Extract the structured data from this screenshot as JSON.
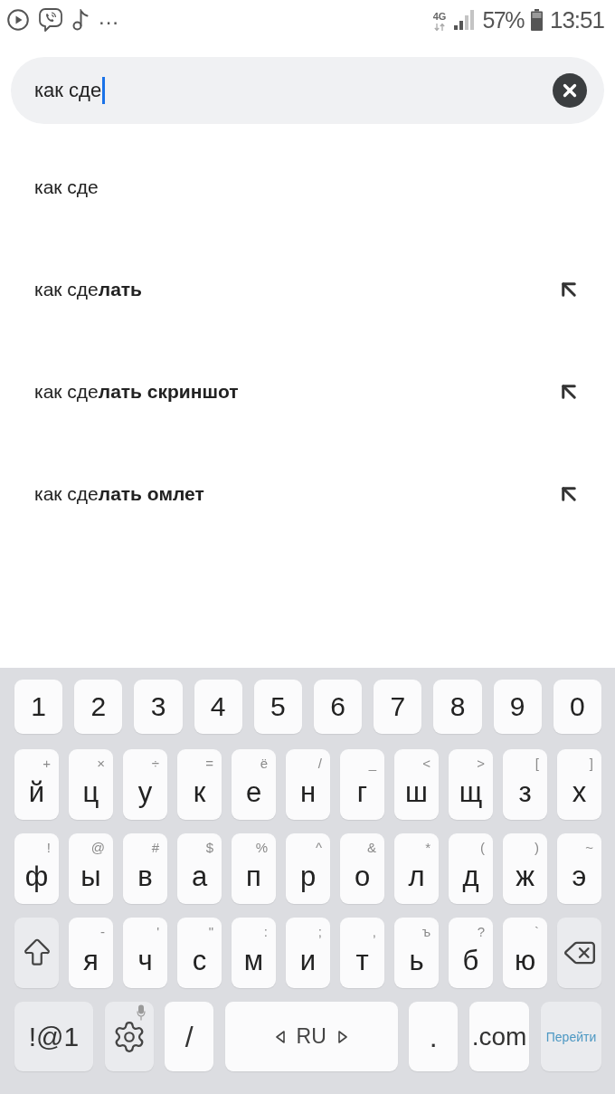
{
  "status_bar": {
    "overflow": "...",
    "network": "4G",
    "battery": "57%",
    "time": "13:51"
  },
  "search": {
    "value": "как сде"
  },
  "suggestions": [
    {
      "text": "как сде",
      "kind": "typed"
    },
    {
      "text": "как сде**лать**",
      "kind": "completion"
    },
    {
      "text": "как сде**лать скриншот**",
      "kind": "completion"
    },
    {
      "text": "как сде**лать омлет**",
      "kind": "completion"
    }
  ],
  "keyboard": {
    "rows": [
      {
        "kind": "numbers",
        "keys": [
          {
            "kind": "char",
            "label": "1"
          },
          {
            "kind": "char",
            "label": "2"
          },
          {
            "kind": "char",
            "label": "3"
          },
          {
            "kind": "char",
            "label": "4"
          },
          {
            "kind": "char",
            "label": "5"
          },
          {
            "kind": "char",
            "label": "6"
          },
          {
            "kind": "char",
            "label": "7"
          },
          {
            "kind": "char",
            "label": "8"
          },
          {
            "kind": "char",
            "label": "9"
          },
          {
            "kind": "char",
            "label": "0"
          }
        ]
      },
      {
        "kind": "letters",
        "keys": [
          {
            "kind": "char",
            "label": "й",
            "hint": "+"
          },
          {
            "kind": "char",
            "label": "ц",
            "hint": "×"
          },
          {
            "kind": "char",
            "label": "у",
            "hint": "÷"
          },
          {
            "kind": "char",
            "label": "к",
            "hint": "="
          },
          {
            "kind": "char",
            "label": "е",
            "hint": "ё"
          },
          {
            "kind": "char",
            "label": "н",
            "hint": "/"
          },
          {
            "kind": "char",
            "label": "г",
            "hint": "_"
          },
          {
            "kind": "char",
            "label": "ш",
            "hint": "<"
          },
          {
            "kind": "char",
            "label": "щ",
            "hint": ">"
          },
          {
            "kind": "char",
            "label": "з",
            "hint": "["
          },
          {
            "kind": "char",
            "label": "х",
            "hint": "]"
          }
        ]
      },
      {
        "kind": "letters",
        "keys": [
          {
            "kind": "char",
            "label": "ф",
            "hint": "!"
          },
          {
            "kind": "char",
            "label": "ы",
            "hint": "@"
          },
          {
            "kind": "char",
            "label": "в",
            "hint": "#"
          },
          {
            "kind": "char",
            "label": "а",
            "hint": "$"
          },
          {
            "kind": "char",
            "label": "п",
            "hint": "%"
          },
          {
            "kind": "char",
            "label": "р",
            "hint": "^"
          },
          {
            "kind": "char",
            "label": "о",
            "hint": "&"
          },
          {
            "kind": "char",
            "label": "л",
            "hint": "*"
          },
          {
            "kind": "char",
            "label": "д",
            "hint": "("
          },
          {
            "kind": "char",
            "label": "ж",
            "hint": ")"
          },
          {
            "kind": "char",
            "label": "э",
            "hint": "~"
          }
        ]
      },
      {
        "kind": "letters",
        "keys": [
          {
            "kind": "shift"
          },
          {
            "kind": "char",
            "label": "я",
            "hint": "-"
          },
          {
            "kind": "char",
            "label": "ч",
            "hint": "'"
          },
          {
            "kind": "char",
            "label": "с",
            "hint": "\""
          },
          {
            "kind": "char",
            "label": "м",
            "hint": ":"
          },
          {
            "kind": "char",
            "label": "и",
            "hint": ";"
          },
          {
            "kind": "char",
            "label": "т",
            "hint": ","
          },
          {
            "kind": "char",
            "label": "ь",
            "hint": "ъ"
          },
          {
            "kind": "char",
            "label": "б",
            "hint": "?"
          },
          {
            "kind": "char",
            "label": "ю",
            "hint": "`"
          },
          {
            "kind": "backspace"
          }
        ]
      },
      {
        "kind": "bottom",
        "keys": [
          {
            "kind": "symbols",
            "label": "!@1"
          },
          {
            "kind": "settings"
          },
          {
            "kind": "char",
            "label": "/"
          },
          {
            "kind": "space",
            "label": "RU"
          },
          {
            "kind": "char",
            "label": "."
          },
          {
            "kind": "char",
            "label": ".com"
          },
          {
            "kind": "go",
            "label": "Перейти"
          }
        ]
      }
    ]
  }
}
